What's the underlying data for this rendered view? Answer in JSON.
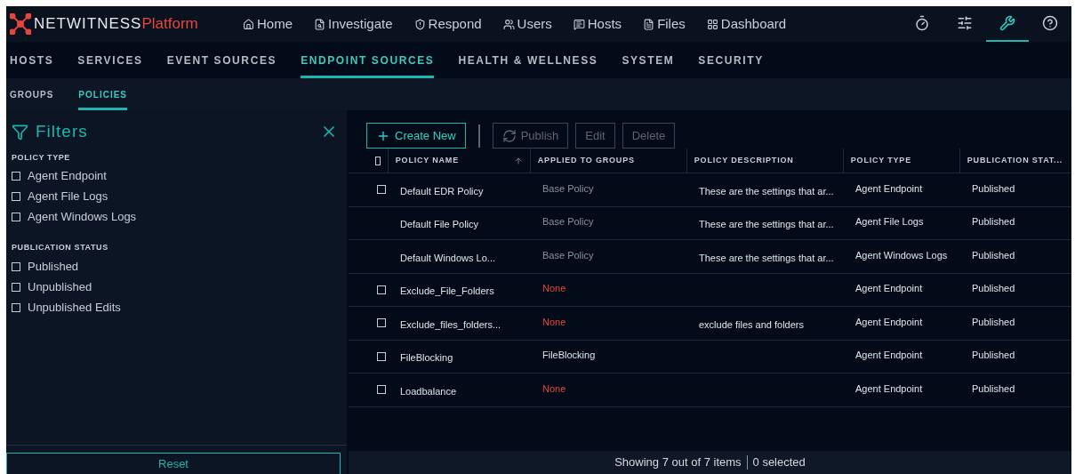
{
  "brand": {
    "name": "NETWITNESS",
    "product": "Platform"
  },
  "main_nav": [
    {
      "label": "Home"
    },
    {
      "label": "Investigate"
    },
    {
      "label": "Respond"
    },
    {
      "label": "Users"
    },
    {
      "label": "Hosts"
    },
    {
      "label": "Files"
    },
    {
      "label": "Dashboard"
    }
  ],
  "tool_icons": [
    {
      "selected": false
    },
    {
      "selected": false
    },
    {
      "selected": true
    },
    {
      "selected": false
    }
  ],
  "admin_tabs": [
    {
      "label": "HOSTS",
      "selected": false
    },
    {
      "label": "SERVICES",
      "selected": false
    },
    {
      "label": "EVENT SOURCES",
      "selected": false
    },
    {
      "label": "ENDPOINT SOURCES",
      "selected": true
    },
    {
      "label": "HEALTH & WELLNESS",
      "selected": false
    },
    {
      "label": "SYSTEM",
      "selected": false
    },
    {
      "label": "SECURITY",
      "selected": false
    }
  ],
  "sub_tabs": [
    {
      "label": "GROUPS",
      "selected": false
    },
    {
      "label": "POLICIES",
      "selected": true
    }
  ],
  "filters": {
    "title": "Filters",
    "sections": [
      {
        "title": "POLICY TYPE",
        "options": [
          {
            "label": "Agent Endpoint",
            "checked": false
          },
          {
            "label": "Agent File Logs",
            "checked": false
          },
          {
            "label": "Agent Windows Logs",
            "checked": false
          }
        ]
      },
      {
        "title": "PUBLICATION STATUS",
        "options": [
          {
            "label": "Published",
            "checked": false
          },
          {
            "label": "Unpublished",
            "checked": false
          },
          {
            "label": "Unpublished Edits",
            "checked": false
          }
        ]
      }
    ],
    "reset": "Reset"
  },
  "toolbar": [
    {
      "label": "Create New",
      "kind": "create",
      "disabled": false
    },
    {
      "label": "Publish",
      "kind": "publish",
      "disabled": true
    },
    {
      "label": "Edit",
      "kind": "plain",
      "disabled": true
    },
    {
      "label": "Delete",
      "kind": "plain",
      "disabled": true
    }
  ],
  "table": {
    "select_all_checked": false,
    "columns": [
      "POLICY NAME",
      "APPLIED TO GROUPS",
      "POLICY DESCRIPTION",
      "POLICY TYPE",
      "PUBLICATION STAT..."
    ],
    "rows": [
      {
        "selectable": true,
        "checked": false,
        "name": "Default EDR Policy",
        "groups": "Base Policy",
        "kind": "base",
        "description": "These are the settings that ar...",
        "type": "Agent Endpoint",
        "status": "Published"
      },
      {
        "selectable": false,
        "name": "Default File Policy",
        "groups": "Base Policy",
        "kind": "base",
        "description": "These are the settings that ar...",
        "type": "Agent File Logs",
        "status": "Published"
      },
      {
        "selectable": false,
        "name": "Default Windows Lo...",
        "groups": "Base Policy",
        "kind": "base",
        "description": "These are the settings that ar...",
        "type": "Agent Windows Logs",
        "status": "Published"
      },
      {
        "selectable": true,
        "checked": false,
        "name": "Exclude_File_Folders",
        "groups": "None",
        "kind": "none",
        "type": "Agent Endpoint",
        "status": "Published"
      },
      {
        "selectable": true,
        "checked": false,
        "name": "Exclude_files_folders...",
        "groups": "None",
        "kind": "none",
        "description": "exclude files and folders",
        "type": "Agent Endpoint",
        "status": "Published"
      },
      {
        "selectable": true,
        "checked": false,
        "name": "FileBlocking",
        "groups": "FileBlocking",
        "kind": "group",
        "type": "Agent Endpoint",
        "status": "Published"
      },
      {
        "selectable": true,
        "checked": false,
        "name": "Loadbalance",
        "groups": "None",
        "kind": "none",
        "type": "Agent Endpoint",
        "status": "Published"
      }
    ]
  },
  "footer": {
    "showing": "Showing 7 out of 7 items",
    "selected": "0 selected"
  }
}
